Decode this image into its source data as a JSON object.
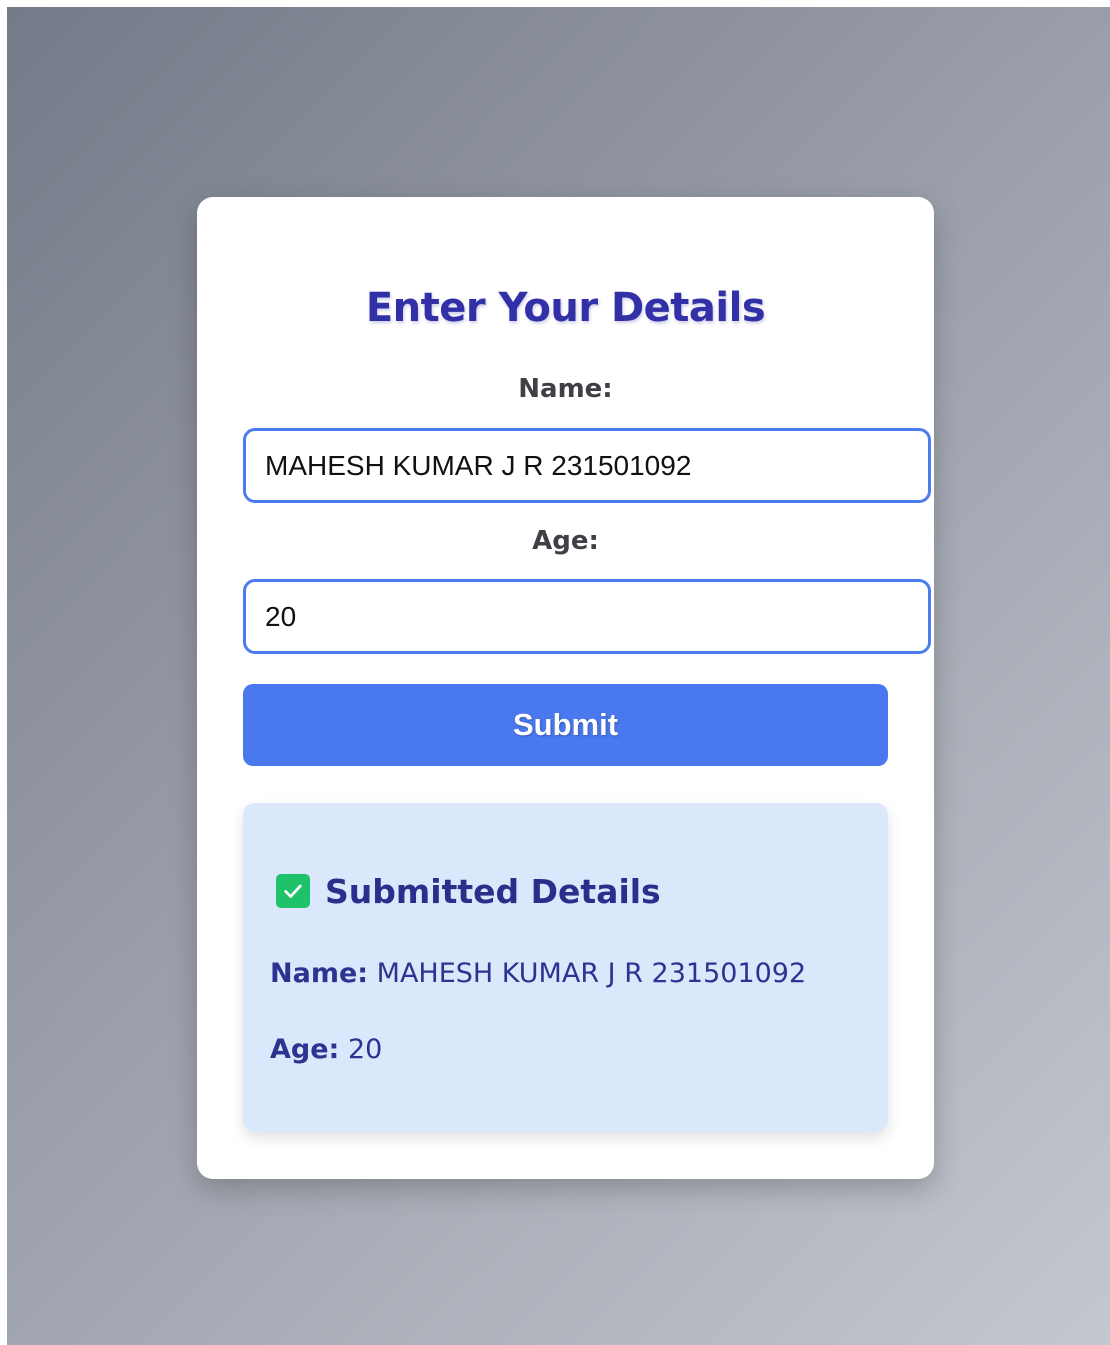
{
  "form": {
    "title": "Enter Your Details",
    "name_label": "Name:",
    "name_value": "MAHESH KUMAR J R 231501092",
    "age_label": "Age:",
    "age_value": "20",
    "submit_label": "Submit"
  },
  "result": {
    "icon": "check-box-icon",
    "title": "Submitted Details",
    "name_key": "Name:",
    "name_value": "MAHESH KUMAR J R 231501092",
    "age_key": "Age:",
    "age_value": "20"
  },
  "colors": {
    "accent": "#4a78ee",
    "title": "#3230a6",
    "panel": "#dbe7fb",
    "check": "#1fc268"
  }
}
